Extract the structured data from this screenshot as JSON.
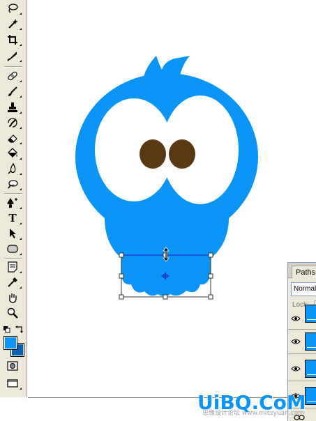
{
  "app": {
    "canvas_background": "#ffffff",
    "ui_background": "#ece9d8"
  },
  "toolbox": {
    "tools": [
      {
        "name": "lasso-tool",
        "icon": "lasso-icon"
      },
      {
        "name": "magic-wand-tool",
        "icon": "magic-wand-icon"
      },
      {
        "name": "crop-tool",
        "icon": "crop-icon"
      },
      {
        "name": "slice-tool",
        "icon": "slice-icon"
      },
      {
        "name": "healing-brush-tool",
        "icon": "bandage-icon"
      },
      {
        "name": "brush-tool",
        "icon": "brush-icon"
      },
      {
        "name": "clone-stamp-tool",
        "icon": "stamp-icon"
      },
      {
        "name": "history-brush-tool",
        "icon": "history-brush-icon"
      },
      {
        "name": "eraser-tool",
        "icon": "eraser-icon"
      },
      {
        "name": "paint-bucket-tool",
        "icon": "paint-bucket-icon"
      },
      {
        "name": "blur-tool",
        "icon": "drop-icon"
      },
      {
        "name": "dodge-tool",
        "icon": "dodge-icon"
      },
      {
        "name": "pen-tool",
        "icon": "pen-icon"
      },
      {
        "name": "type-tool",
        "icon": "type-icon",
        "label": "T"
      },
      {
        "name": "path-selection-tool",
        "icon": "arrow-icon"
      },
      {
        "name": "shape-tool",
        "icon": "rounded-rect-icon"
      },
      {
        "name": "notes-tool",
        "icon": "notes-icon"
      },
      {
        "name": "eyedropper-tool",
        "icon": "eyedropper-icon"
      },
      {
        "name": "hand-tool",
        "icon": "hand-icon"
      },
      {
        "name": "zoom-tool",
        "icon": "zoom-icon"
      }
    ],
    "foreground_color": "#0a95f6",
    "background_color": "#0563b5"
  },
  "artwork": {
    "bird_color": "#0a95f6",
    "eye_white": "#ffffff",
    "pupil_color": "#5a3812",
    "selection_color": "#1a1acc",
    "transform_handle_color": "#ffffff"
  },
  "panel": {
    "tab_label": "Paths",
    "blend_mode": "Normal",
    "lock_label": "Lock:",
    "layers": [
      {
        "thumb_color": "#0a95f6"
      },
      {
        "thumb_color": "#0a95f6"
      },
      {
        "thumb_color": "#0a95f6"
      },
      {
        "thumb_color": "#0a95f6"
      }
    ]
  },
  "watermark": {
    "text": "UiBQ.CoM",
    "sub_text": "思缘设计论坛 www.missyuan.com"
  }
}
